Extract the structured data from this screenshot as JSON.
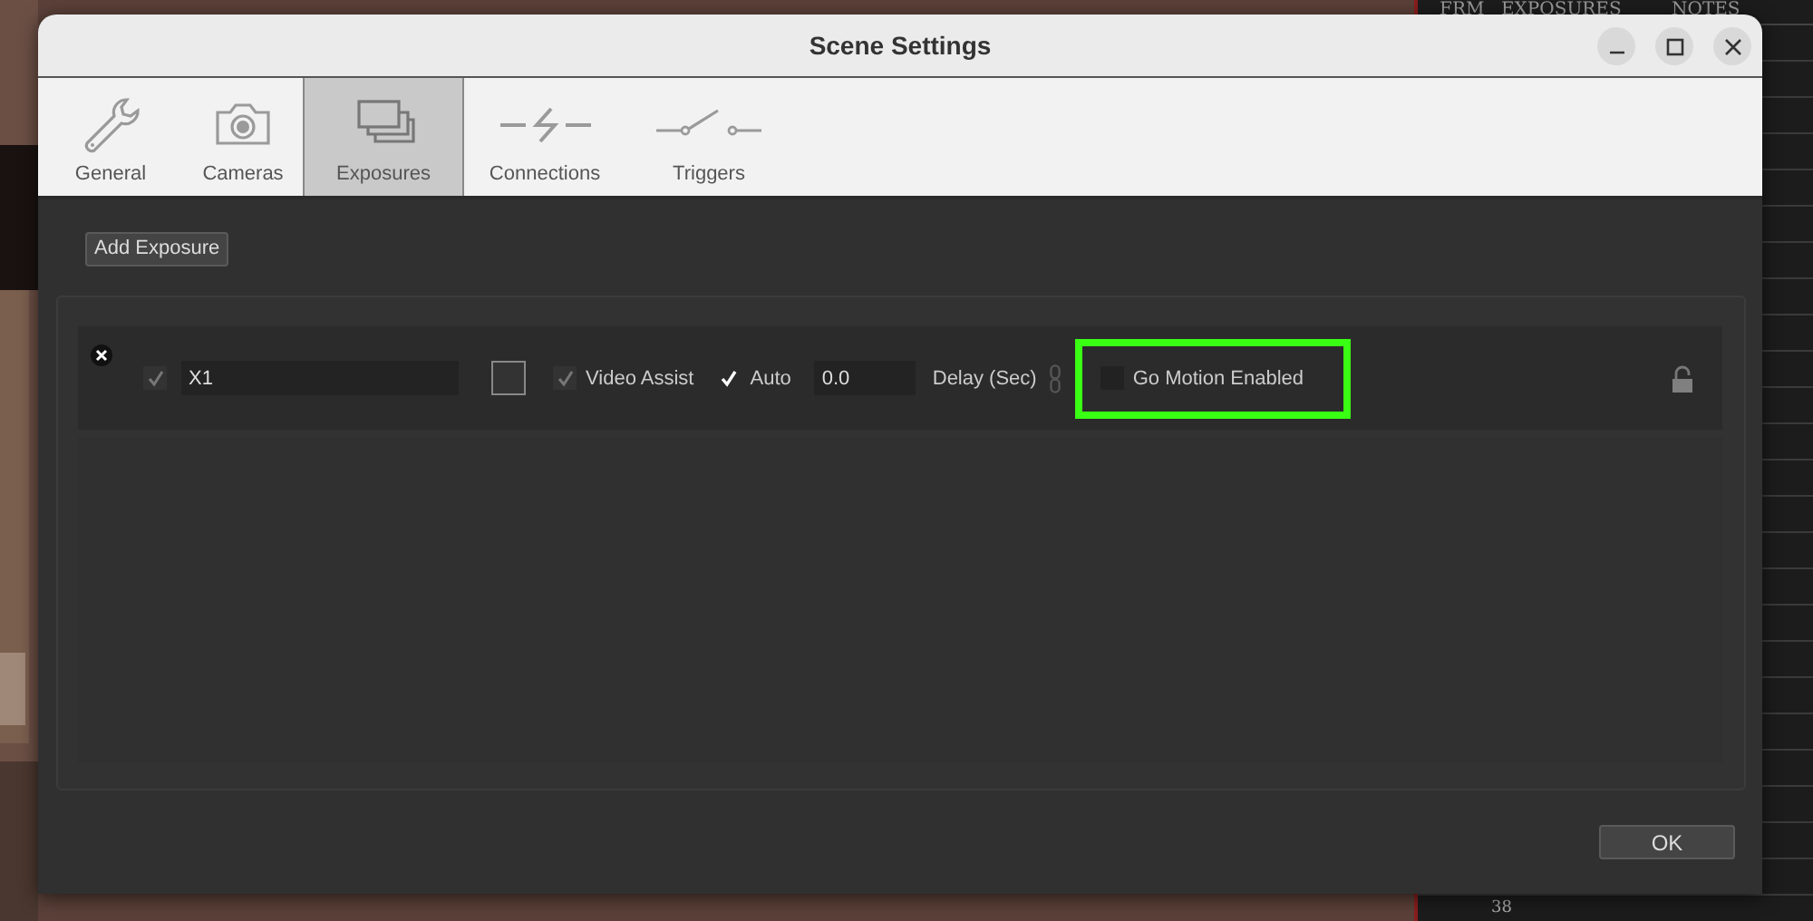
{
  "background": {
    "kind": "picture",
    "sheet_headers": [
      "FRM",
      "EXPOSURES",
      "NOTES"
    ],
    "row_numbers": [
      "38"
    ]
  },
  "window": {
    "title": "Scene Settings"
  },
  "tabs": [
    {
      "label": "General",
      "selected": false
    },
    {
      "label": "Cameras",
      "selected": false
    },
    {
      "label": "Exposures",
      "selected": true
    },
    {
      "label": "Connections",
      "selected": false
    },
    {
      "label": "Triggers",
      "selected": false
    }
  ],
  "add_button": "Add Exposure",
  "exposures": [
    {
      "enabled": true,
      "name": "X1",
      "video_assist": {
        "label": "Video Assist",
        "checked": true
      },
      "auto": {
        "label": "Auto",
        "checked": true
      },
      "delay": "0.0",
      "delay_label": "Delay (Sec)",
      "go_motion": {
        "label": "Go Motion Enabled",
        "checked": false,
        "highlighted": true
      },
      "locked": false
    }
  ],
  "ok_button": "OK"
}
